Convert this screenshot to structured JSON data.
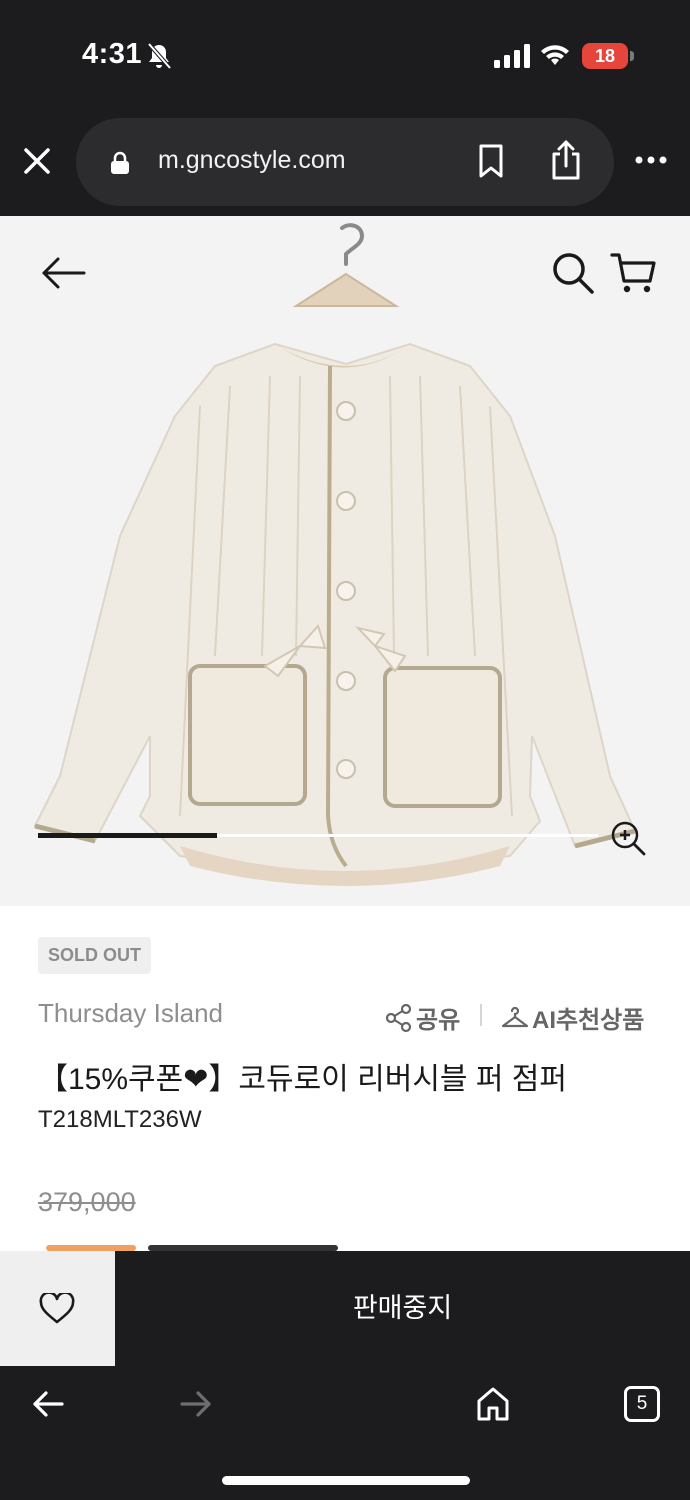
{
  "status_bar": {
    "time": "4:31",
    "battery": "18",
    "icons": [
      "bell-slash-icon",
      "cellular-signal-icon",
      "wifi-icon",
      "battery-icon"
    ]
  },
  "browser": {
    "url": "m.gncostyle.com",
    "icons": [
      "close-icon",
      "lock-icon",
      "bookmark-icon",
      "share-icon",
      "more-icon"
    ]
  },
  "hero": {
    "icons": [
      "back-arrow-icon",
      "search-icon",
      "cart-icon",
      "zoom-in-icon"
    ],
    "gallery_progress": 0.32
  },
  "product": {
    "badge": "SOLD OUT",
    "brand": "Thursday Island",
    "share_label": "공유",
    "ai_label": "AI추천상품",
    "title": "【15%쿠폰❤】코듀로이 리버시블 퍼 점퍼",
    "code": "T218MLT236W",
    "original_price": "379,000"
  },
  "buy_bar": {
    "action_label": "판매중지",
    "icons": [
      "heart-icon"
    ]
  },
  "toolbar": {
    "tab_count": "5",
    "icons": [
      "back-icon",
      "forward-icon",
      "home-icon",
      "tabs-icon"
    ]
  },
  "colors": {
    "dark_chrome": "#1c1c1e",
    "url_pill": "#2c2c2e",
    "battery_low": "#e5453a",
    "badge_bg": "#efefef",
    "muted_text": "#8e8e8e"
  }
}
